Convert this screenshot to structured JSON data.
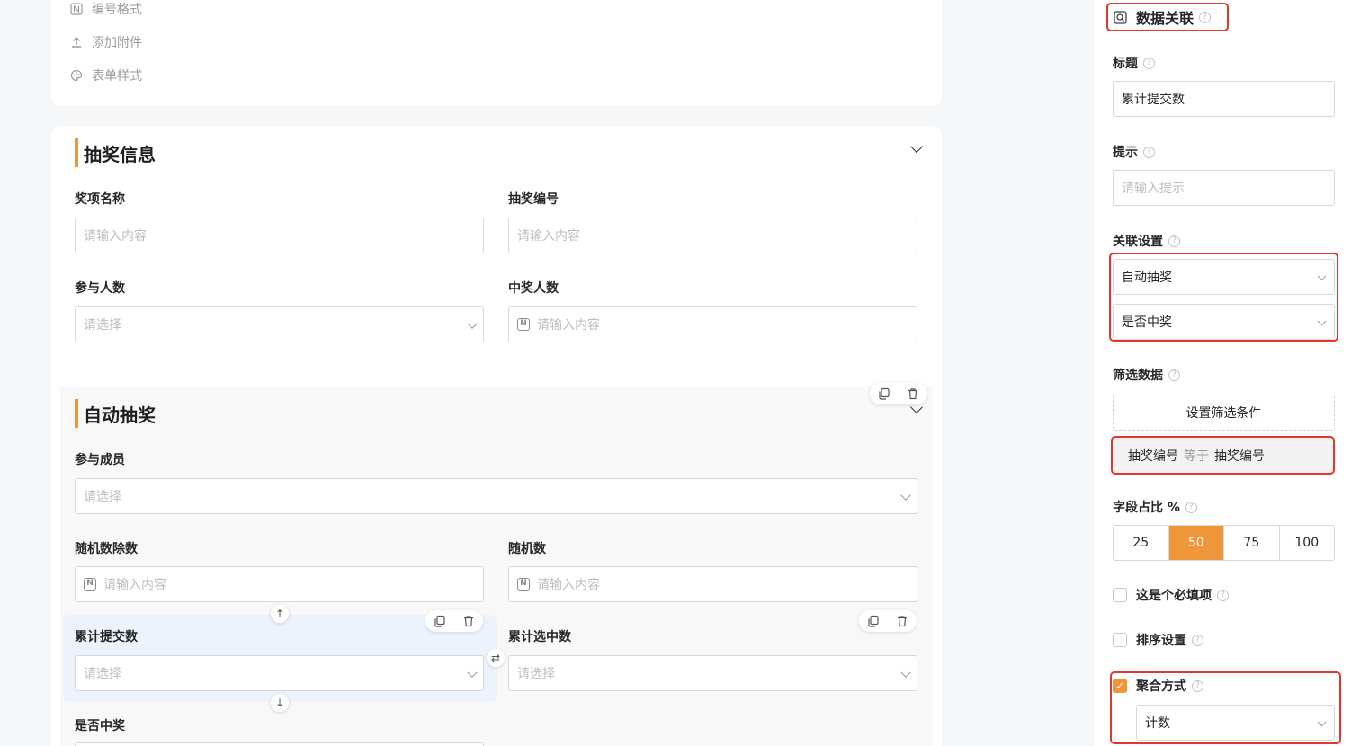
{
  "top_menu": [
    {
      "icon": "number-format-icon",
      "label": "编号格式"
    },
    {
      "icon": "upload-icon",
      "label": "添加附件"
    },
    {
      "icon": "palette-icon",
      "label": "表单样式"
    }
  ],
  "section_lottery": {
    "title": "抽奖信息",
    "fields": [
      {
        "label": "奖项名称",
        "placeholder": "请输入内容"
      },
      {
        "label": "抽奖编号",
        "placeholder": "请输入内容"
      },
      {
        "label": "参与人数",
        "placeholder": "请选择"
      },
      {
        "label": "中奖人数",
        "placeholder": "请输入内容"
      }
    ]
  },
  "section_auto": {
    "title": "自动抽奖",
    "fields": [
      {
        "label": "参与成员",
        "placeholder": "请选择"
      },
      {
        "label": "随机数除数",
        "placeholder": "请输入内容"
      },
      {
        "label": "随机数",
        "placeholder": "请输入内容"
      },
      {
        "label": "累计提交数",
        "placeholder": "请选择"
      },
      {
        "label": "累计选中数",
        "placeholder": "请选择"
      },
      {
        "label": "是否中奖",
        "placeholder": ""
      }
    ]
  },
  "panel": {
    "header": "数据关联",
    "title_label": "标题",
    "title_value": "累计提交数",
    "hint_label": "提示",
    "hint_placeholder": "请输入提示",
    "relation_label": "关联设置",
    "relation_form": "自动抽奖",
    "relation_field": "是否中奖",
    "filter_label": "筛选数据",
    "filter_button": "设置筛选条件",
    "filter_left": "抽奖编号",
    "filter_op": "等于",
    "filter_right": "抽奖编号",
    "ratio_label": "字段占比 %",
    "ratio_options": [
      "25",
      "50",
      "75",
      "100"
    ],
    "ratio_selected": "50",
    "required_label": "这是个必填项",
    "sort_label": "排序设置",
    "aggregate_label": "聚合方式",
    "aggregate_value": "计数",
    "help_glyph": "?"
  },
  "colors": {
    "accent": "#f0963a",
    "highlight": "#e0392b",
    "selected_bg": "#edf3fc"
  }
}
